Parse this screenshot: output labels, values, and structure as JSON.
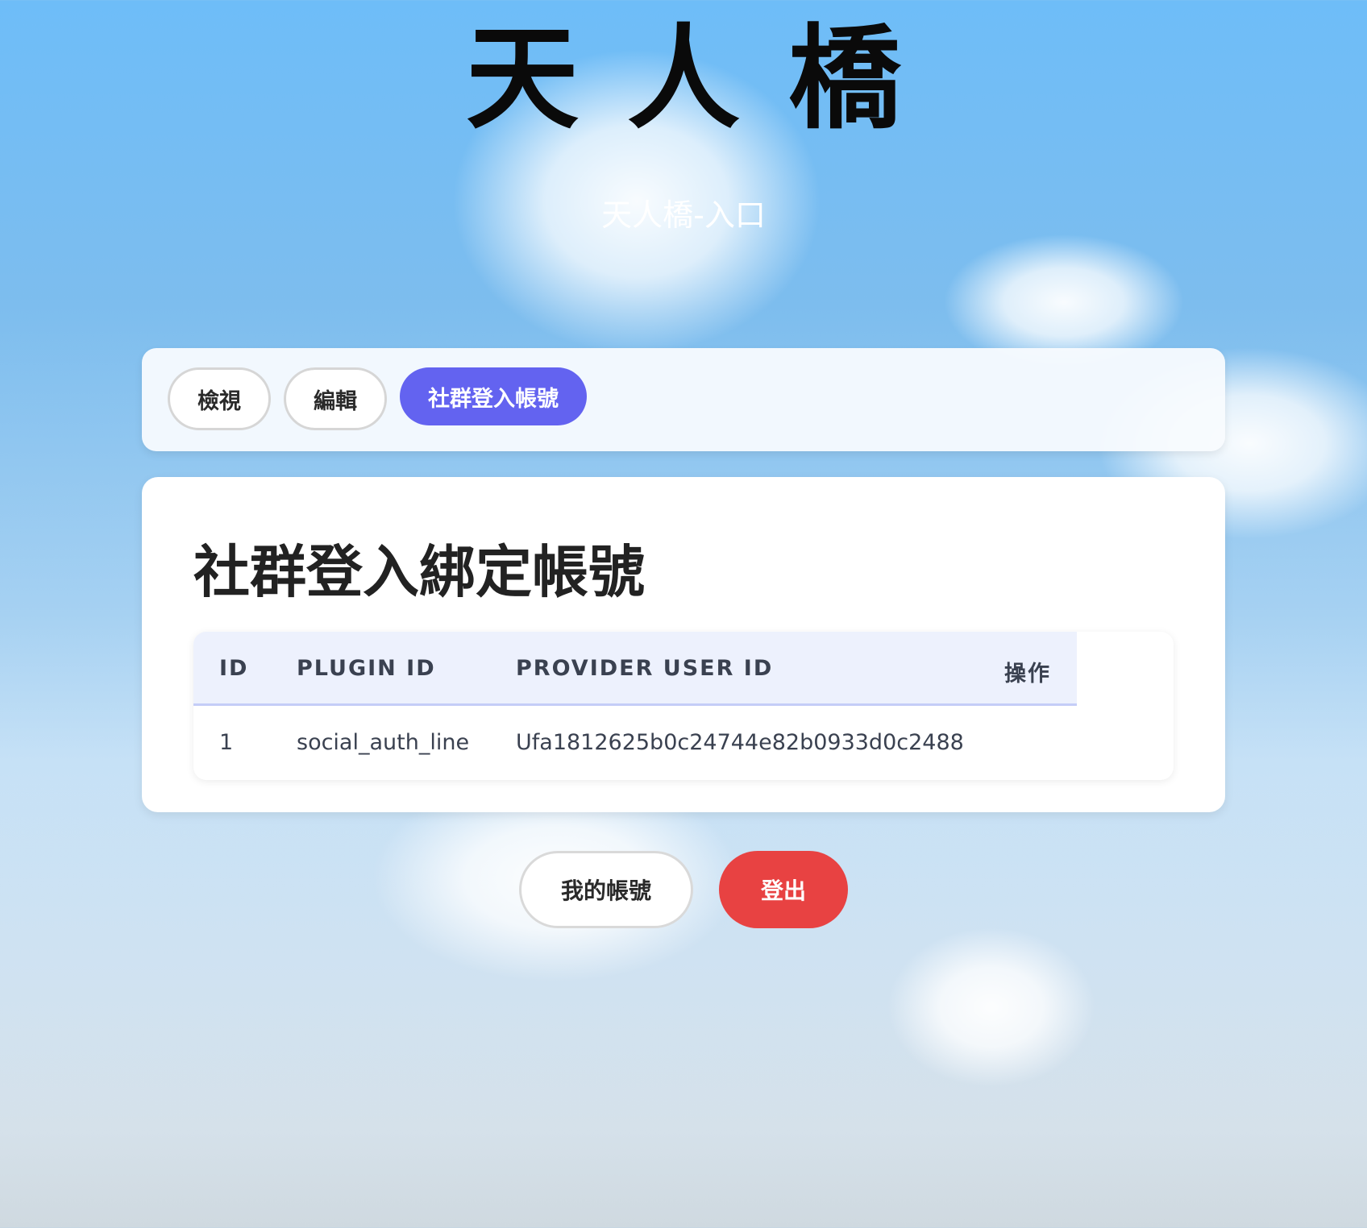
{
  "header": {
    "logo_text": "天人橋",
    "subtitle": "天人橋-入口"
  },
  "tabs": [
    {
      "label": "檢視",
      "active": false
    },
    {
      "label": "編輯",
      "active": false
    },
    {
      "label": "社群登入帳號",
      "active": true
    }
  ],
  "main": {
    "title": "社群登入綁定帳號",
    "table": {
      "columns": [
        "ID",
        "PLUGIN ID",
        "PROVIDER USER ID",
        "操作"
      ],
      "rows": [
        [
          "1",
          "social_auth_line",
          "Ufa1812625b0c24744e82b0933d0c2488",
          ""
        ]
      ]
    }
  },
  "footer": {
    "my_account_label": "我的帳號",
    "logout_label": "登出"
  },
  "colors": {
    "accent": "#6363f0",
    "danger": "#e84242"
  }
}
